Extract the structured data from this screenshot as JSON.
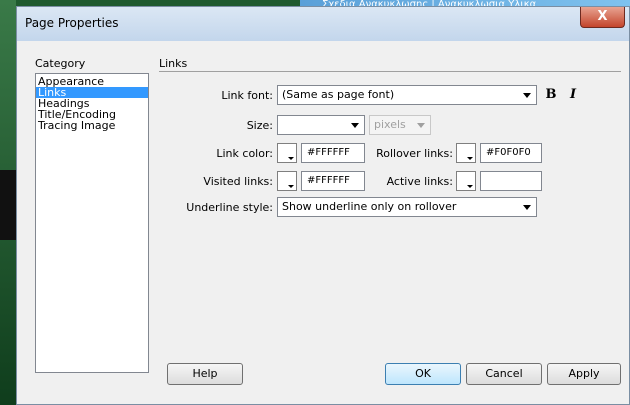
{
  "background": {
    "window_title_snippet": "Σχεδια Ανακυκλωσης | Ανακυκλωσια Υλικα"
  },
  "dialog": {
    "title": "Page Properties",
    "close_label": "X",
    "category_heading": "Category",
    "categories": [
      "Appearance",
      "Links",
      "Headings",
      "Title/Encoding",
      "Tracing Image"
    ],
    "selected_category": "Links",
    "panel_heading": "Links",
    "fields": {
      "link_font_label": "Link font:",
      "link_font_value": "(Same as page font)",
      "bold_label": "B",
      "italic_label": "I",
      "size_label": "Size:",
      "size_value": "",
      "size_unit": "pixels",
      "link_color_label": "Link color:",
      "link_color_value": "#FFFFFF",
      "rollover_label": "Rollover links:",
      "rollover_value": "#F0F0F0",
      "visited_label": "Visited links:",
      "visited_value": "#FFFFFF",
      "active_label": "Active links:",
      "active_value": "",
      "underline_label": "Underline style:",
      "underline_value": "Show underline only on rollover"
    },
    "buttons": {
      "help": "Help",
      "ok": "OK",
      "cancel": "Cancel",
      "apply": "Apply"
    }
  }
}
